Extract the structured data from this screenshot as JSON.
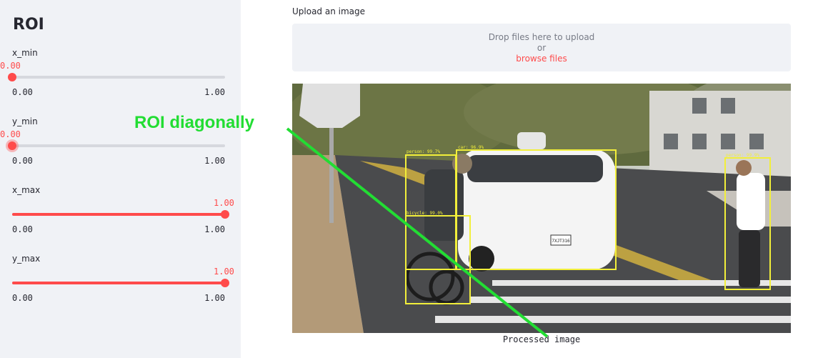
{
  "sidebar": {
    "title": "ROI",
    "sliders": [
      {
        "label": "x_min",
        "value": "0.00",
        "min": "0.00",
        "max": "1.00",
        "fraction": 0.0
      },
      {
        "label": "y_min",
        "value": "0.00",
        "min": "0.00",
        "max": "1.00",
        "fraction": 0.0
      },
      {
        "label": "x_max",
        "value": "1.00",
        "min": "0.00",
        "max": "1.00",
        "fraction": 1.0
      },
      {
        "label": "y_max",
        "value": "1.00",
        "min": "0.00",
        "max": "1.00",
        "fraction": 1.0
      }
    ]
  },
  "main": {
    "upload_label": "Upload an image",
    "drop_text": "Drop files here to upload",
    "or_text": "or",
    "browse_text": "browse files",
    "caption": "Processed image",
    "detections": [
      {
        "label": "person: 99.7%"
      },
      {
        "label": "car: 96.9%"
      },
      {
        "label": "bicycle: 99.0%"
      },
      {
        "label": "person: 99.9%"
      }
    ],
    "license_plate": "7XJT316"
  },
  "annotation": {
    "text": "ROI diagonally"
  },
  "colors": {
    "accent": "#ff4b4b",
    "sidebar_bg": "#f0f2f6",
    "box": "#f2ef3a",
    "annotation": "#22dd33"
  }
}
